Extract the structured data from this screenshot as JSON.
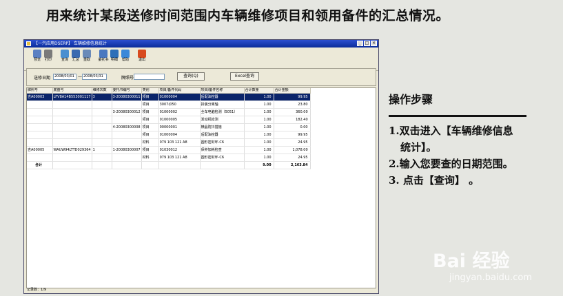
{
  "heading": "用来统计某段送修时间范围内车辆维修项目和领用备件的汇总情况。",
  "window": {
    "title": "【一汽应用DSERP】   车辆维修信息统计",
    "controls": [
      "_",
      "□",
      "×"
    ]
  },
  "toolbar": [
    {
      "label": "预览",
      "icon": "preview-icon",
      "color": "#5a7fc2"
    },
    {
      "label": "打印",
      "icon": "print-icon",
      "color": "#7a7a7a"
    },
    {
      "label": "查询",
      "icon": "search-icon",
      "color": "#4a8fd0"
    },
    {
      "label": "汇总",
      "icon": "summary-icon",
      "color": "#3a6ab0"
    },
    {
      "label": "重取",
      "icon": "refresh-icon",
      "color": "#6a8ab8"
    },
    {
      "label": "委托书",
      "icon": "document-icon",
      "color": "#4a78c0"
    },
    {
      "label": "明细",
      "icon": "detail-icon",
      "color": "#2d6fb8"
    },
    {
      "label": "帮助",
      "icon": "help-icon",
      "color": "#3a88d8"
    },
    {
      "label": "退出",
      "icon": "exit-icon",
      "color": "#d84a1e"
    }
  ],
  "filter": {
    "date_label": "送修日期",
    "date_from": "2008/03/01",
    "date_sep": "—",
    "date_to": "2008/03/31",
    "plate_label": "牌照号",
    "plate_value": "",
    "query_button": "查询(Q)",
    "excel_button": "Excel查询"
  },
  "table": {
    "columns": [
      "牌照号",
      "底盘号",
      "维修次数",
      "委托书编号",
      "类别",
      "项目/备件代码",
      "项目/备件名称",
      "合计数量",
      "合计金额"
    ],
    "rows": [
      [
        "吉A00003",
        "LFV8A14B553001117",
        "3",
        "3-20080300011",
        "项目",
        "01000004",
        "后配油控器",
        "1.00",
        "99.95"
      ],
      [
        "",
        "",
        "",
        "",
        "项目",
        "3007(050",
        "拆装分离轴",
        "1.00",
        "23.80"
      ],
      [
        "",
        "",
        "",
        "3-20080300012",
        "项目",
        "01000002",
        "全车电脑检测（5051）",
        "1.00",
        "360.00"
      ],
      [
        "",
        "",
        "",
        "",
        "项目",
        "01000005",
        "发动机检测",
        "1.00",
        "182.40"
      ],
      [
        "",
        "",
        "",
        "4-20080300008",
        "项目",
        "00000001",
        "横晶防抖措施",
        "1.00",
        "0.00"
      ],
      [
        "",
        "",
        "",
        "",
        "项目",
        "01000004",
        "后配油控器",
        "1.00",
        "99.95"
      ],
      [
        "",
        "",
        "",
        "",
        "材料",
        "079 103 121 A8",
        "圆形密封环-C6",
        "1.00",
        "24.95"
      ],
      [
        "吉A00005",
        "WAUW94LTTD029364",
        "1",
        "1-20080300007",
        "项目",
        "01030012",
        "保养加耗检查",
        "1.00",
        "1,078.00"
      ],
      [
        "",
        "",
        "",
        "",
        "材料",
        "079 103 121 A8",
        "圆形密封环-C6",
        "1.00",
        "24.95"
      ]
    ],
    "total": {
      "label": "合计",
      "qty": "9.00",
      "amount": "2,163.84"
    }
  },
  "status": "记录数：1/9",
  "steps": {
    "title": "操作步骤",
    "items": [
      {
        "num": "1.",
        "text": "双击进入【车辆维修信息",
        "cont": "统计】。"
      },
      {
        "num": "2.",
        "text": "输入您要查的日期范围。"
      },
      {
        "num": "3.",
        "text": " 点击【查询】 。"
      }
    ]
  },
  "watermark": {
    "logo": "Bai 经验",
    "url": "jingyan.baidu.com"
  }
}
